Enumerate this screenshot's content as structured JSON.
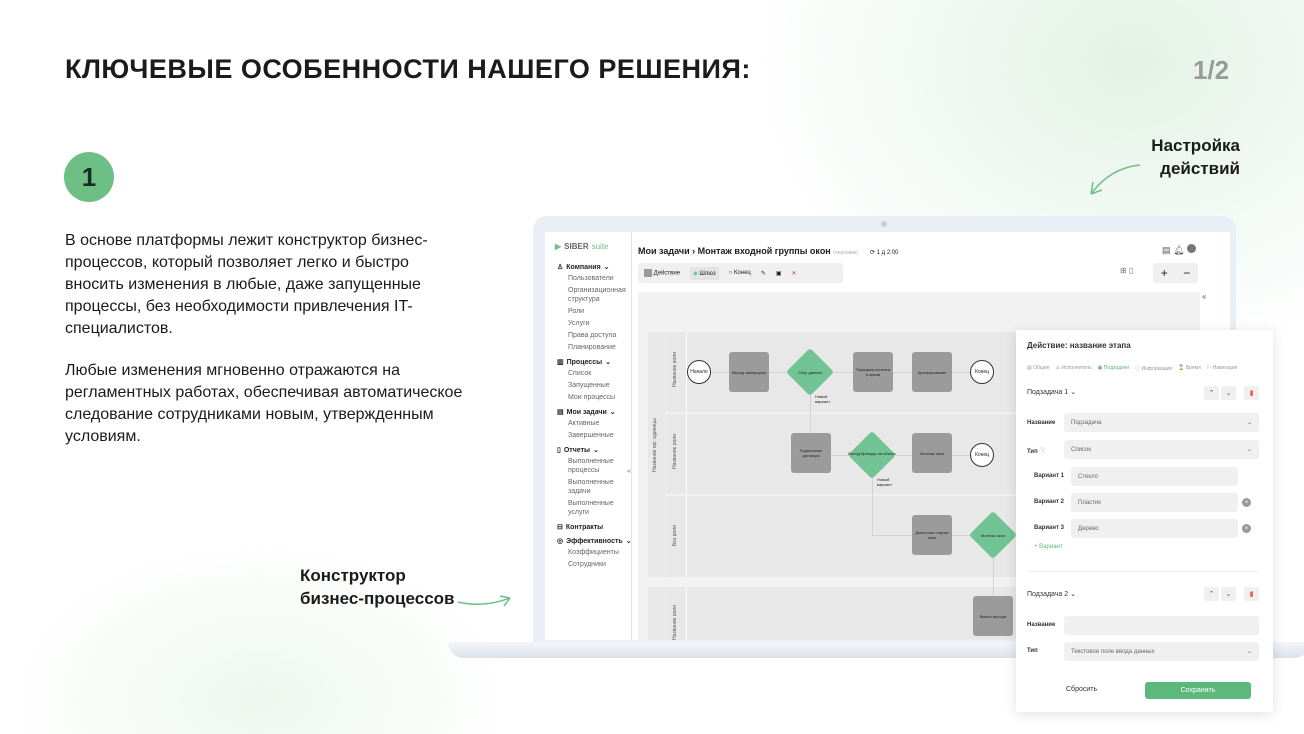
{
  "slide": {
    "title": "КЛЮЧЕВЫЕ ОСОБЕННОСТИ НАШЕГО РЕШЕНИЯ:",
    "page": "1/2",
    "number": "1",
    "paragraph1": "В основе платформы лежит конструктор бизнес-процессов, который позволяет легко и быстро вносить изменения в любые, даже запущенные процессы, без необходимости привлечения IT-специалистов.",
    "paragraph2": "Любые изменения мгновенно отражаются на регламентных работах, обеспечивая автоматическое следование сотрудниками новым, утвержденным условиям.",
    "callout_actions": [
      "Настройка",
      "действий"
    ],
    "callout_builder": [
      "Конструктор",
      "бизнес-процессов"
    ],
    "accent": "#6dbf86"
  },
  "app": {
    "logo": "SIBER",
    "logo_suffix": "suite",
    "sidebar": [
      {
        "label": "Компания",
        "icon": "user-icon",
        "items": [
          "Пользователи",
          "Организационная структура",
          "Роли",
          "Услуги",
          "Права доступа",
          "Планирование"
        ]
      },
      {
        "label": "Процессы",
        "icon": "chart-icon",
        "items": [
          "Список",
          "Запущенные",
          "Мои процессы"
        ]
      },
      {
        "label": "Мои задачи",
        "icon": "tasks-icon",
        "items": [
          "Активные",
          "Завершенные"
        ]
      },
      {
        "label": "Отчеты",
        "icon": "clipboard-icon",
        "items": [
          "Выполненные процессы",
          "Выполненные задачи",
          "Выполненные услуги"
        ]
      },
      {
        "label": "Контракты",
        "icon": "briefcase-icon",
        "items": []
      },
      {
        "label": "Эффективность",
        "icon": "target-icon",
        "items": [
          "Коэффициенты",
          "Сотрудники"
        ]
      }
    ],
    "breadcrumb": [
      "Мои задачи",
      "Монтаж входной группы окон"
    ],
    "status": "(черновик)",
    "timer": "1 д  2:00",
    "toolbar": {
      "action": "Действие",
      "gateway": "Шлюз",
      "end": "Конец"
    },
    "diagram": {
      "org_unit": "Название орг. единицы",
      "lanes": [
        "Название роли",
        "Название роли",
        "Без роли",
        "Название роли"
      ],
      "start": "Начало",
      "end": "Конец",
      "new_variant": "Новый вариант",
      "nodes": [
        "Выезд замерщика",
        "Сбор данных",
        "Передача клиента в архив",
        "Архивирование",
        "Подписание договора",
        "Выезд бригады на объект",
        "Монтаж окон",
        "Демонтаж старых окон",
        "Монтаж окон",
        "Вывоз мусора"
      ]
    },
    "panel": {
      "title": "Действие: название этапа",
      "tabs": [
        "Общее",
        "Исполнитель",
        "Подзадачи",
        "Информация",
        "Время",
        "Навигация"
      ],
      "active_tab": 2,
      "subtask1": {
        "label": "Подзадача 1",
        "name_label": "Название",
        "name_value": "Подзадача",
        "type_label": "Тип",
        "type_value": "Список",
        "variants": [
          {
            "label": "Вариант 1",
            "value": "Стекло"
          },
          {
            "label": "Вариант 2",
            "value": "Пластик"
          },
          {
            "label": "Вариант 3",
            "value": "Дерево"
          }
        ],
        "add_variant": "Вариант"
      },
      "subtask2": {
        "label": "Подзадача 2",
        "name_label": "Название",
        "name_value": "",
        "type_label": "Тип",
        "type_value": "Текстовое поле ввода данных"
      },
      "reset": "Сбросить",
      "save": "Сохранить"
    }
  }
}
